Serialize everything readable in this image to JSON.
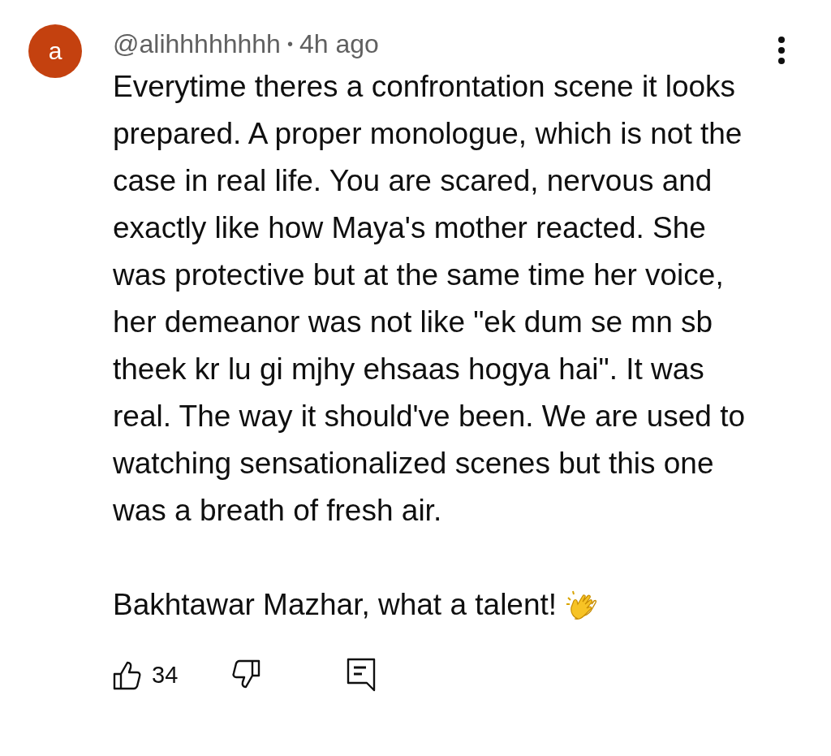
{
  "comment": {
    "avatar_letter": "a",
    "author": "@alihhhhhhhh",
    "separator": "•",
    "time": "4h ago",
    "paragraphs": [
      "Everytime theres a confrontation scene it looks prepared. A proper monologue, which is not the case in real life. You are scared, nervous and exactly like how Maya's mother reacted. She was protective but at the same time her voice, her demeanor was not like \"ek dum se mn sb theek kr lu gi mjhy ehsaas hogya hai\". It was real. The way it should've been. We are used to watching sensationalized scenes but this one was a breath of fresh air.",
      "Bakhtawar Mazhar, what a talent!"
    ],
    "like_count": "34"
  }
}
